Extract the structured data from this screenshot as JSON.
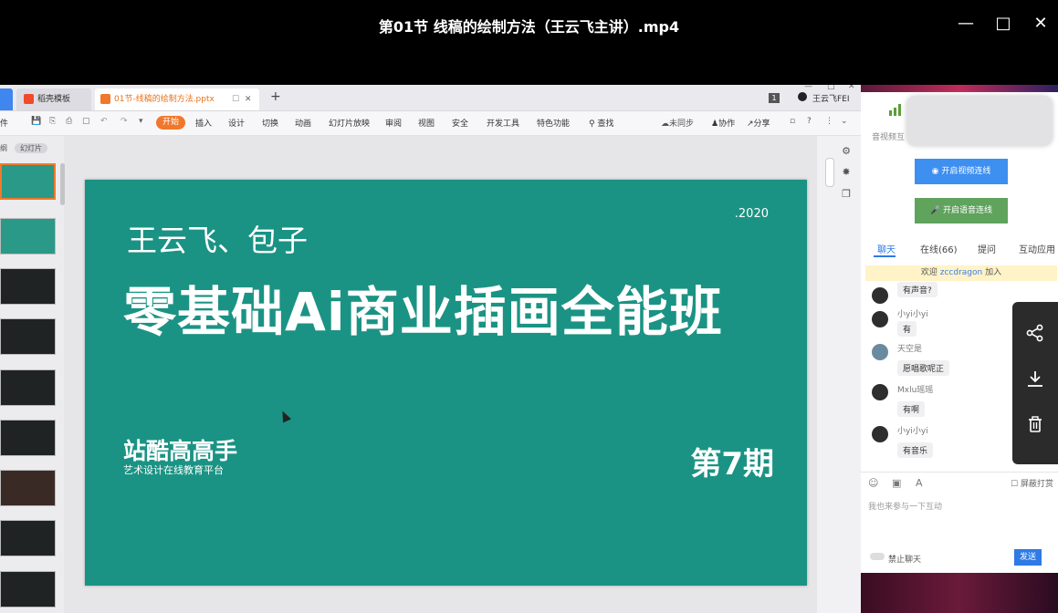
{
  "window": {
    "title": "第01节 线稿的绘制方法（王云飞主讲）.mp4"
  },
  "ppt": {
    "tabs": [
      {
        "label": "稻壳模板"
      },
      {
        "label": "01节-线稿的绘制方法.pptx"
      }
    ],
    "user": "王云飞FEI",
    "page_indicator": "1",
    "menu": [
      "件",
      "开始",
      "插入",
      "设计",
      "切换",
      "动画",
      "幻灯片放映",
      "审阅",
      "视图",
      "安全",
      "开发工具",
      "特色功能",
      "查找"
    ],
    "sync": "未同步",
    "collab": "协作",
    "share": "分享",
    "thumb_tabs": [
      "纲",
      "幻灯片"
    ]
  },
  "slide": {
    "year": ".2020",
    "names": "王云飞、包子",
    "course": "零基础Ai商业插画全能班",
    "brand": "站酷高高手",
    "brand_sub": "艺术设计在线教育平台",
    "term": "第7期"
  },
  "live": {
    "hud_label": "音视频互",
    "btn_video": "开启视频连线",
    "btn_audio": "开启语音连线",
    "tabs": [
      "聊天",
      "在线(66)",
      "提问",
      "互动应用"
    ],
    "welcome_prefix": "欢迎",
    "welcome_user": "zccdragon",
    "welcome_suffix": "加入",
    "messages": [
      {
        "user": "",
        "text": "有声音?"
      },
      {
        "user": "小yi小yi",
        "text": "有"
      },
      {
        "user": "天空是",
        "text": "愿唱歌呢正"
      },
      {
        "user": "Mxlu瑶瑶",
        "text": "有啊"
      },
      {
        "user": "小yi小yi",
        "text": "有音乐"
      }
    ],
    "shield_label": "屏蔽打赏",
    "input_placeholder": "我也来参与一下互动",
    "forbid_label": "禁止聊天",
    "send_label": "发送"
  },
  "colors": {
    "slide_bg": "#1b9384",
    "accent_orange": "#f0772b",
    "accent_blue": "#2f7ae5"
  },
  "icons": [
    "minimize-icon",
    "maximize-icon",
    "close-icon",
    "share-icon",
    "download-icon",
    "trash-icon"
  ]
}
